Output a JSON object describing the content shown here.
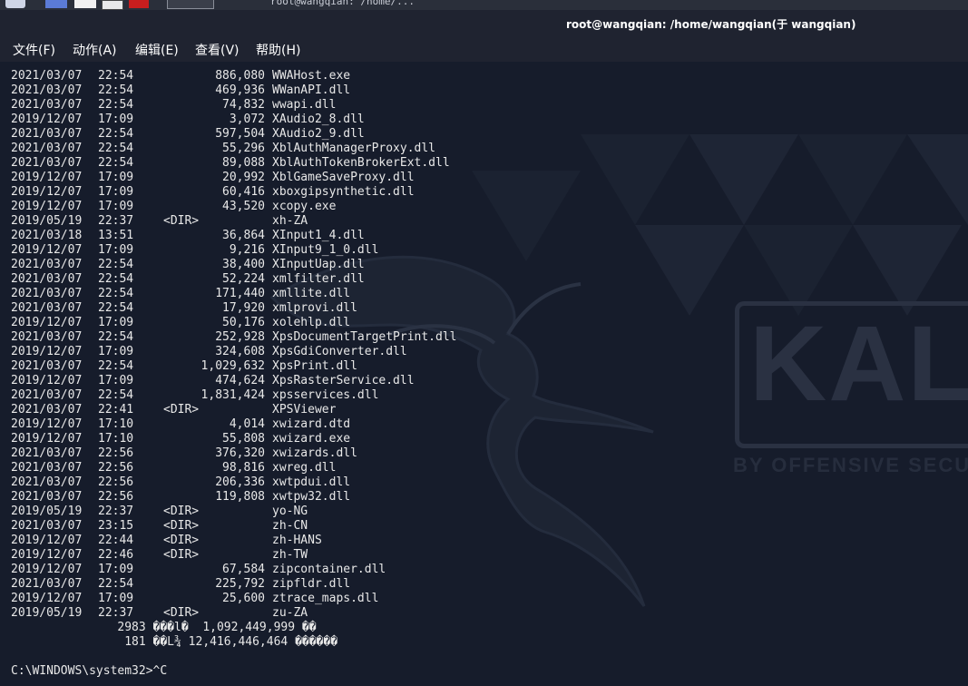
{
  "panel": {
    "window_title": "root@wangqian: /home/..."
  },
  "window": {
    "title": "root@wangqian: /home/wangqian(于 wangqian)"
  },
  "menu": [
    {
      "label": "文件(F)"
    },
    {
      "label": "动作(A)"
    },
    {
      "label": "编辑(E)"
    },
    {
      "label": "查看(V)"
    },
    {
      "label": "帮助(H)"
    }
  ],
  "wallpaper": {
    "logo_text": "KAL",
    "tagline": "BY OFFENSIVE SECU"
  },
  "listing": [
    {
      "date": "2021/03/07",
      "time": "22:54",
      "size": "886,080",
      "name": "WWAHost.exe"
    },
    {
      "date": "2021/03/07",
      "time": "22:54",
      "size": "469,936",
      "name": "WWanAPI.dll"
    },
    {
      "date": "2021/03/07",
      "time": "22:54",
      "size": "74,832",
      "name": "wwapi.dll"
    },
    {
      "date": "2019/12/07",
      "time": "17:09",
      "size": "3,072",
      "name": "XAudio2_8.dll"
    },
    {
      "date": "2021/03/07",
      "time": "22:54",
      "size": "597,504",
      "name": "XAudio2_9.dll"
    },
    {
      "date": "2021/03/07",
      "time": "22:54",
      "size": "55,296",
      "name": "XblAuthManagerProxy.dll"
    },
    {
      "date": "2021/03/07",
      "time": "22:54",
      "size": "89,088",
      "name": "XblAuthTokenBrokerExt.dll"
    },
    {
      "date": "2019/12/07",
      "time": "17:09",
      "size": "20,992",
      "name": "XblGameSaveProxy.dll"
    },
    {
      "date": "2019/12/07",
      "time": "17:09",
      "size": "60,416",
      "name": "xboxgipsynthetic.dll"
    },
    {
      "date": "2019/12/07",
      "time": "17:09",
      "size": "43,520",
      "name": "xcopy.exe"
    },
    {
      "date": "2019/05/19",
      "time": "22:37",
      "dir": "<DIR>",
      "name": "xh-ZA"
    },
    {
      "date": "2021/03/18",
      "time": "13:51",
      "size": "36,864",
      "name": "XInput1_4.dll"
    },
    {
      "date": "2019/12/07",
      "time": "17:09",
      "size": "9,216",
      "name": "XInput9_1_0.dll"
    },
    {
      "date": "2021/03/07",
      "time": "22:54",
      "size": "38,400",
      "name": "XInputUap.dll"
    },
    {
      "date": "2021/03/07",
      "time": "22:54",
      "size": "52,224",
      "name": "xmlfilter.dll"
    },
    {
      "date": "2021/03/07",
      "time": "22:54",
      "size": "171,440",
      "name": "xmllite.dll"
    },
    {
      "date": "2021/03/07",
      "time": "22:54",
      "size": "17,920",
      "name": "xmlprovi.dll"
    },
    {
      "date": "2019/12/07",
      "time": "17:09",
      "size": "50,176",
      "name": "xolehlp.dll"
    },
    {
      "date": "2021/03/07",
      "time": "22:54",
      "size": "252,928",
      "name": "XpsDocumentTargetPrint.dll"
    },
    {
      "date": "2019/12/07",
      "time": "17:09",
      "size": "324,608",
      "name": "XpsGdiConverter.dll"
    },
    {
      "date": "2021/03/07",
      "time": "22:54",
      "size": "1,029,632",
      "name": "XpsPrint.dll"
    },
    {
      "date": "2019/12/07",
      "time": "17:09",
      "size": "474,624",
      "name": "XpsRasterService.dll"
    },
    {
      "date": "2021/03/07",
      "time": "22:54",
      "size": "1,831,424",
      "name": "xpsservices.dll"
    },
    {
      "date": "2021/03/07",
      "time": "22:41",
      "dir": "<DIR>",
      "name": "XPSViewer"
    },
    {
      "date": "2019/12/07",
      "time": "17:10",
      "size": "4,014",
      "name": "xwizard.dtd"
    },
    {
      "date": "2019/12/07",
      "time": "17:10",
      "size": "55,808",
      "name": "xwizard.exe"
    },
    {
      "date": "2021/03/07",
      "time": "22:56",
      "size": "376,320",
      "name": "xwizards.dll"
    },
    {
      "date": "2021/03/07",
      "time": "22:56",
      "size": "98,816",
      "name": "xwreg.dll"
    },
    {
      "date": "2021/03/07",
      "time": "22:56",
      "size": "206,336",
      "name": "xwtpdui.dll"
    },
    {
      "date": "2021/03/07",
      "time": "22:56",
      "size": "119,808",
      "name": "xwtpw32.dll"
    },
    {
      "date": "2019/05/19",
      "time": "22:37",
      "dir": "<DIR>",
      "name": "yo-NG"
    },
    {
      "date": "2021/03/07",
      "time": "23:15",
      "dir": "<DIR>",
      "name": "zh-CN"
    },
    {
      "date": "2019/12/07",
      "time": "22:44",
      "dir": "<DIR>",
      "name": "zh-HANS"
    },
    {
      "date": "2019/12/07",
      "time": "22:46",
      "dir": "<DIR>",
      "name": "zh-TW"
    },
    {
      "date": "2019/12/07",
      "time": "17:09",
      "size": "67,584",
      "name": "zipcontainer.dll"
    },
    {
      "date": "2021/03/07",
      "time": "22:54",
      "size": "225,792",
      "name": "zipfldr.dll"
    },
    {
      "date": "2019/12/07",
      "time": "17:09",
      "size": "25,600",
      "name": "ztrace_maps.dll"
    },
    {
      "date": "2019/05/19",
      "time": "22:37",
      "dir": "<DIR>",
      "name": "zu-ZA"
    }
  ],
  "summary": [
    "               2983 ���l�  1,092,449,999 ��",
    "                181 ��L¾ 12,416,446,464 ������"
  ],
  "prompt": "C:\\WINDOWS\\system32>^C"
}
